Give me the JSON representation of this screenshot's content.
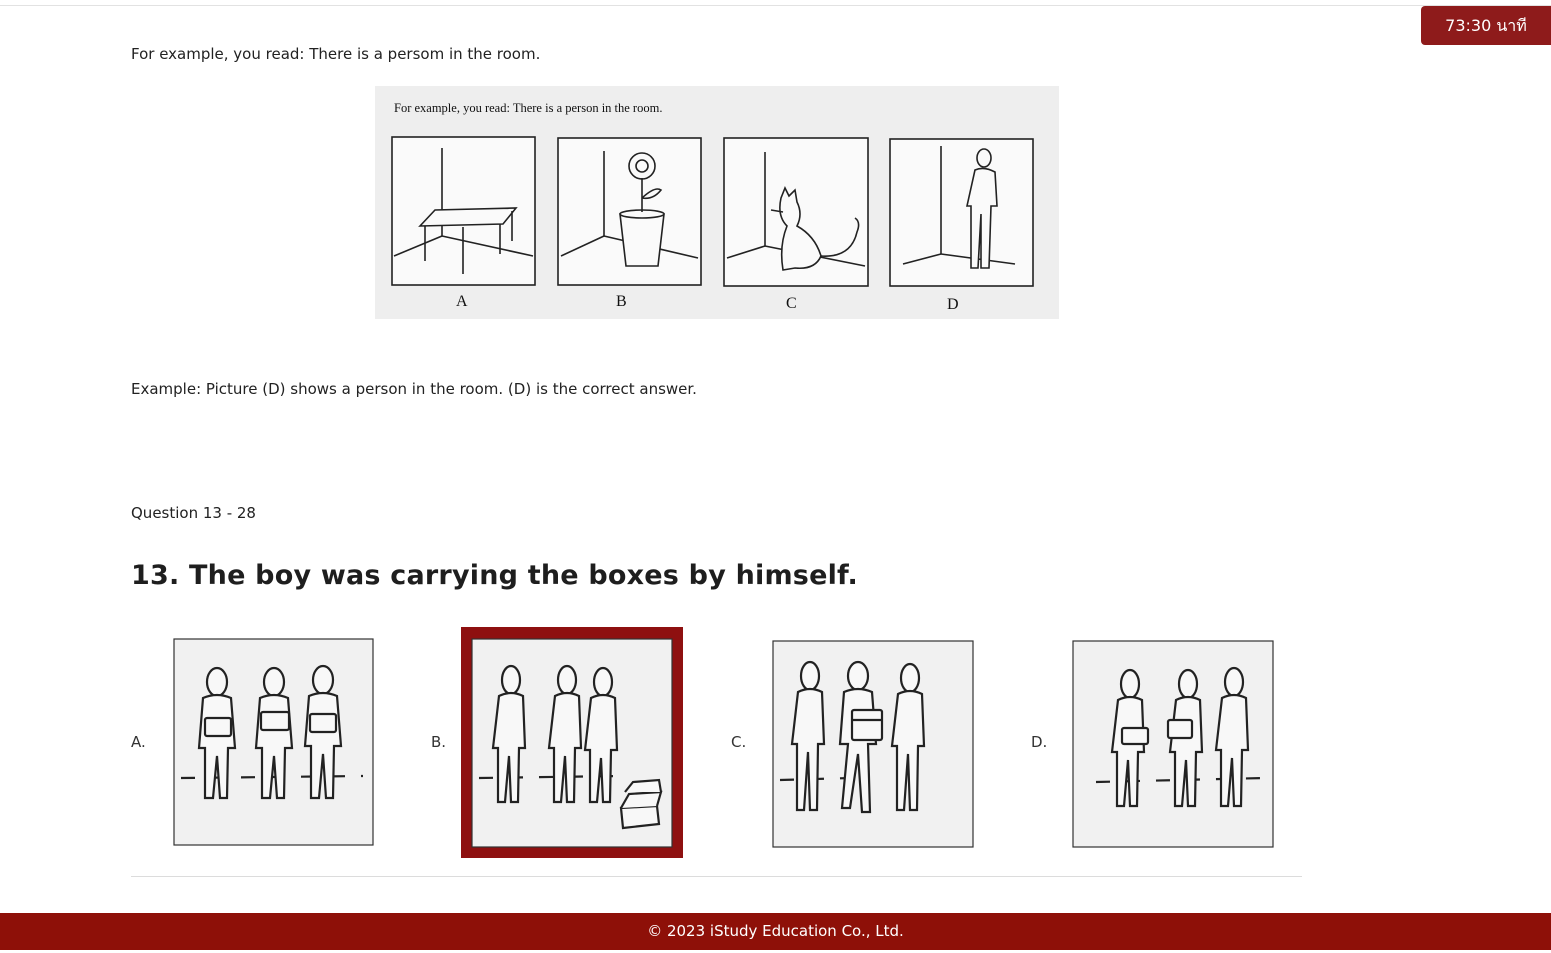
{
  "timer": {
    "label": "73:30 นาที"
  },
  "intro": {
    "example_sentence": "For example, you read: There is a persom in the room.",
    "figure": {
      "caption": "For example, you read:  There is a person in the room.",
      "labels": [
        "A",
        "B",
        "C",
        "D"
      ]
    },
    "explanation": "Example: Picture (D) shows a person in the room. (D) is the correct answer."
  },
  "section": {
    "label": "Question 13 - 28"
  },
  "question": {
    "title": "13. The boy was carrying the boxes by himself.",
    "options": [
      {
        "letter": "A.",
        "selected": false
      },
      {
        "letter": "B.",
        "selected": true
      },
      {
        "letter": "C.",
        "selected": false
      },
      {
        "letter": "D.",
        "selected": false
      }
    ]
  },
  "footer": {
    "copyright": "© 2023 iStudy Education Co., Ltd."
  },
  "colors": {
    "accent": "#8e1b1b",
    "footer": "#8e1008"
  }
}
